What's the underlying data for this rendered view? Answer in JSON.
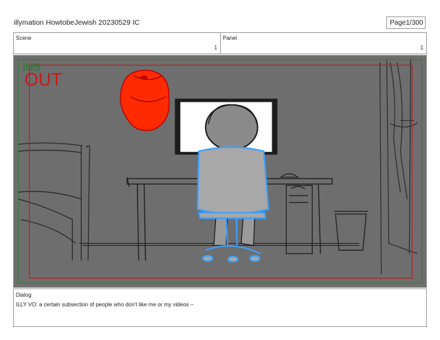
{
  "header": {
    "title": "illymation HowtobeJewish 20230529 IC",
    "page_label": "Page",
    "page_value": "1/300"
  },
  "scene": {
    "label": "Scene",
    "value": "1"
  },
  "panel": {
    "label": "Panel",
    "value": "1",
    "overlay_text_small": "INS",
    "overlay_text_large": "OUT"
  },
  "dialog": {
    "label": "Dialog",
    "text": "ILLY VO: a certain subsection of people who don't like me or my videos –"
  },
  "colors": {
    "panel_bg": "#6e6e6e",
    "safe_area": "#b22222",
    "cap": "#ff2a00",
    "chair": "#3aa0ff"
  }
}
